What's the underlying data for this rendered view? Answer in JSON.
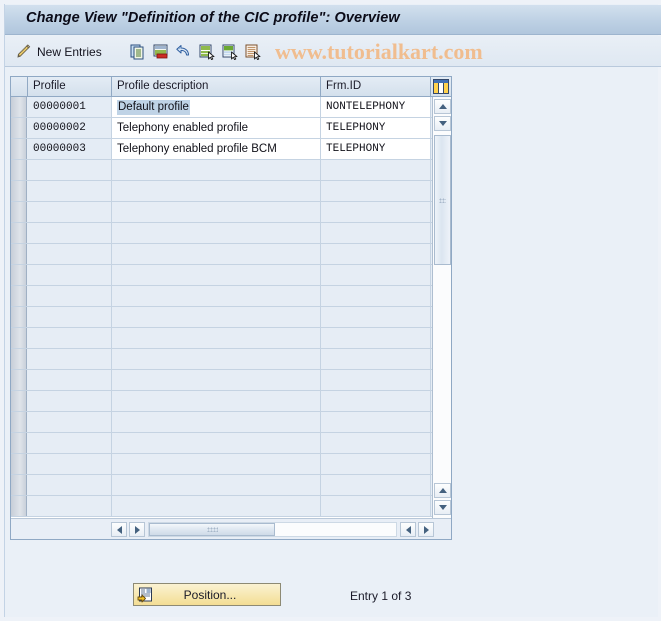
{
  "window": {
    "title": "Change View \"Definition of the CIC profile\": Overview"
  },
  "toolbar": {
    "change_icon": "pencil-change-icon",
    "new_entries_label": "New Entries",
    "icons": [
      {
        "name": "copy-as-icon",
        "title": "Copy As..."
      },
      {
        "name": "delete-icon",
        "title": "Delete"
      },
      {
        "name": "undo-icon",
        "title": "Undo Change"
      },
      {
        "name": "select-all-icon",
        "title": "Select All"
      },
      {
        "name": "select-block-icon",
        "title": "Select Block"
      },
      {
        "name": "deselect-all-icon",
        "title": "Deselect All"
      }
    ],
    "watermark": "www.tutorialkart.com"
  },
  "table": {
    "columns": [
      {
        "key": "profile",
        "label": "Profile"
      },
      {
        "key": "description",
        "label": "Profile description"
      },
      {
        "key": "frm_id",
        "label": "Frm.ID"
      }
    ],
    "config_icon": "column-settings-icon",
    "rows": [
      {
        "profile": "00000001",
        "description": "Default profile",
        "frm_id": "NONTELEPHONY",
        "highlighted": true
      },
      {
        "profile": "00000002",
        "description": "Telephony enabled profile",
        "frm_id": "TELEPHONY",
        "highlighted": false
      },
      {
        "profile": "00000003",
        "description": "Telephony enabled profile BCM",
        "frm_id": "TELEPHONY",
        "highlighted": false
      }
    ],
    "empty_row_count": 17,
    "vertical_scrollbar": {
      "up_icon": "scroll-up-icon",
      "down_icon": "scroll-down-icon"
    },
    "horizontal_scrollbar": {
      "left_icon": "scroll-left-icon",
      "right_icon": "scroll-right-icon"
    }
  },
  "footer": {
    "position_button_label": "Position...",
    "position_button_icon": "position-icon",
    "entry_status": "Entry 1 of 3"
  },
  "colors": {
    "title_bar": "#bed1e4",
    "toolbar": "#e3ebf4",
    "row_alt": "#e6edf5",
    "highlight": "#bfd3e6",
    "button_yellow": "#f5e3a8",
    "watermark": "#f0bd8f"
  }
}
